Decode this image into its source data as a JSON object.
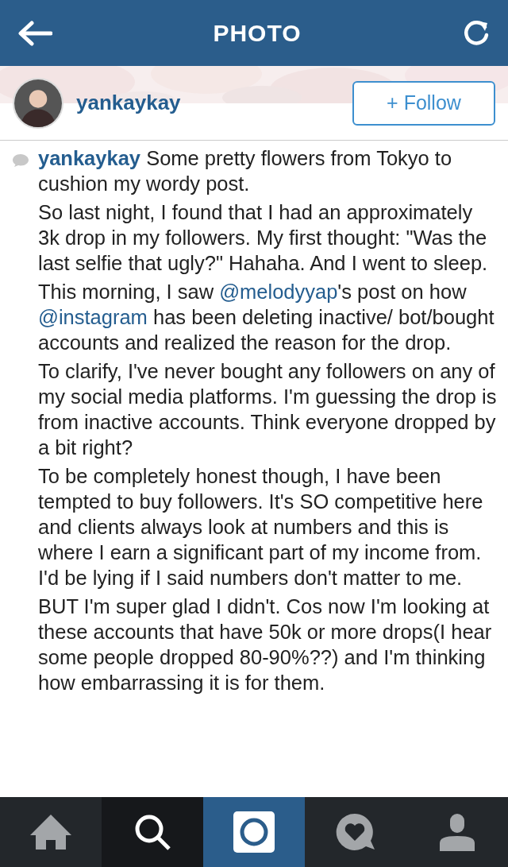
{
  "header": {
    "title": "PHOTO"
  },
  "user": {
    "username": "yankaykay",
    "follow_label": "+ Follow"
  },
  "caption": {
    "username": "yankaykay",
    "paragraphs": [
      [
        {
          "kind": "text",
          "text": " Some pretty flowers from Tokyo to cushion my wordy post."
        }
      ],
      [
        {
          "kind": "text",
          "text": "So last night, I found that I had an approximately 3k drop in my followers. My first thought: \"Was the last selfie that ugly?\" Hahaha. And I went to sleep."
        }
      ],
      [
        {
          "kind": "text",
          "text": "This morning, I saw "
        },
        {
          "kind": "mention",
          "text": "@melodyyap"
        },
        {
          "kind": "text",
          "text": "'s post on how "
        },
        {
          "kind": "mention",
          "text": "@instagram"
        },
        {
          "kind": "text",
          "text": " has been deleting inactive/ bot/bought accounts and realized the reason for the drop."
        }
      ],
      [
        {
          "kind": "text",
          "text": "To clarify, I've never bought any followers on any of my social media platforms. I'm guessing the drop is from inactive accounts. Think everyone dropped by a bit right?"
        }
      ],
      [
        {
          "kind": "text",
          "text": "To be completely honest though, I have been tempted to buy followers. It's SO competitive here and clients always look at numbers and this is where I earn a significant part of my income from. I'd be lying if I said numbers don't matter to me."
        }
      ],
      [
        {
          "kind": "text",
          "text": "BUT I'm super glad I didn't. Cos now I'm looking at these accounts that have 50k or more drops(I hear some people dropped 80-90%??) and I'm thinking how embarrassing it is for them."
        }
      ]
    ]
  },
  "tabs": [
    {
      "kind": "home",
      "selected": false
    },
    {
      "kind": "search",
      "selected": true
    },
    {
      "kind": "camera",
      "selected": false
    },
    {
      "kind": "activity",
      "selected": false
    },
    {
      "kind": "profile",
      "selected": false
    }
  ]
}
